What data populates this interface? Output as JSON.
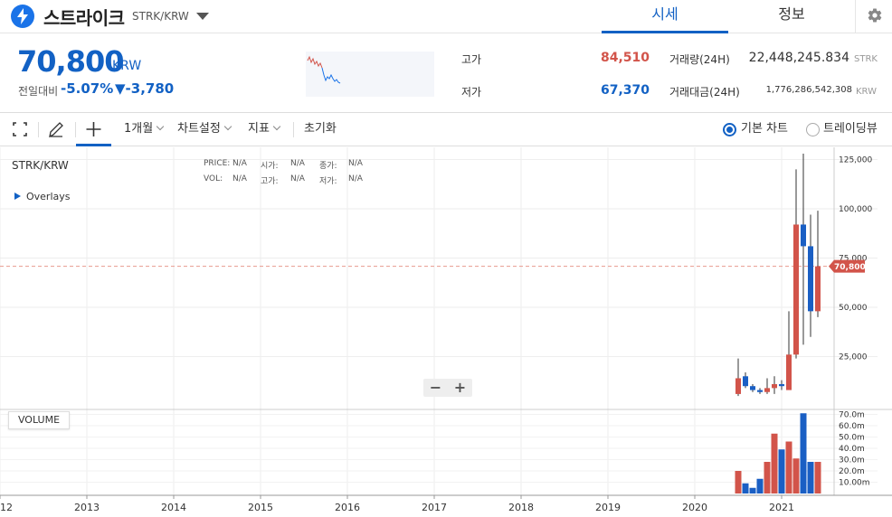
{
  "header": {
    "coin_name": "스트라이크",
    "coin_pair": "STRK/KRW",
    "tabs": [
      {
        "label": "시세"
      },
      {
        "label": "정보"
      }
    ]
  },
  "price": {
    "current": "70,800",
    "unit": "KRW",
    "change_label": "전일대비",
    "change_rate": "-5.07%",
    "change_amount": "▼-3,780"
  },
  "stats": {
    "high_label": "고가",
    "high_value": "84,510",
    "low_label": "저가",
    "low_value": "67,370",
    "volume_label": "거래량(24H)",
    "volume_value": "22,448,245.834",
    "volume_unit": "STRK",
    "amount_label": "거래대금(24H)",
    "amount_value": "1,776,286,542,308",
    "amount_unit": "KRW"
  },
  "toolbar": {
    "period": "1개월",
    "chart_settings": "차트설정",
    "indicators": "지표",
    "reset": "초기화",
    "radio_basic": "기본 차트",
    "radio_trading": "트레이딩뷰"
  },
  "chart": {
    "symbol": "STRK/KRW",
    "overlays": "Overlays",
    "volume_button": "VOLUME",
    "info": {
      "price_label": "PRICE:",
      "price_val": "N/A",
      "open_label": "시가:",
      "open_val": "N/A",
      "close_label": "종가:",
      "close_val": "N/A",
      "vol_label": "VOL:",
      "vol_val": "N/A",
      "high_label": "고가:",
      "high_val": "N/A",
      "low_label": "저가:",
      "low_val": "N/A"
    },
    "zoom_out": "−",
    "zoom_in": "+",
    "current_price_tag": "70,800"
  },
  "colors": {
    "up": "#d2544a",
    "down": "#1a5fc4",
    "accent": "#1261c4"
  },
  "chart_data": {
    "type": "bar",
    "y_ticks": [
      "125,000",
      "100,000",
      "75,000",
      "50,000",
      "25,000"
    ],
    "y_tick_values": [
      125000,
      100000,
      75000,
      50000,
      25000
    ],
    "vol_ticks": [
      "70.0m",
      "60.0m",
      "50.0m",
      "40.0m",
      "30.0m",
      "20.0m",
      "10.00m"
    ],
    "vol_tick_values": [
      70,
      60,
      50,
      40,
      30,
      20,
      10
    ],
    "x_ticks": [
      "12",
      "2013",
      "2014",
      "2015",
      "2016",
      "2017",
      "2018",
      "2019",
      "2020",
      "2021"
    ],
    "current_price": 70800,
    "candles": [
      {
        "date": "2020-07",
        "open": 6000,
        "high": 24000,
        "low": 5000,
        "close": 14000,
        "volume": 20
      },
      {
        "date": "2020-08",
        "open": 15000,
        "high": 17000,
        "low": 9000,
        "close": 10000,
        "volume": 9
      },
      {
        "date": "2020-09",
        "open": 10000,
        "high": 11000,
        "low": 7000,
        "close": 8000,
        "volume": 5
      },
      {
        "date": "2020-10",
        "open": 8000,
        "high": 9000,
        "low": 6000,
        "close": 7000,
        "volume": 13
      },
      {
        "date": "2020-11",
        "open": 7000,
        "high": 14000,
        "low": 6000,
        "close": 9000,
        "volume": 28
      },
      {
        "date": "2020-12",
        "open": 9000,
        "high": 15000,
        "low": 6000,
        "close": 11000,
        "volume": 53
      },
      {
        "date": "2021-01",
        "open": 11000,
        "high": 13000,
        "low": 8000,
        "close": 10000,
        "volume": 39
      },
      {
        "date": "2021-02",
        "open": 8000,
        "high": 48000,
        "low": 8000,
        "close": 26000,
        "volume": 46
      },
      {
        "date": "2021-03",
        "open": 26000,
        "high": 120000,
        "low": 24000,
        "close": 92000,
        "volume": 31
      },
      {
        "date": "2021-04",
        "open": 92000,
        "high": 128000,
        "low": 31000,
        "close": 81000,
        "volume": 71
      },
      {
        "date": "2021-05",
        "open": 81000,
        "high": 97000,
        "low": 35000,
        "close": 48000,
        "volume": 28
      },
      {
        "date": "2021-06",
        "open": 48000,
        "high": 99000,
        "low": 45000,
        "close": 70800,
        "volume": 28
      }
    ]
  }
}
